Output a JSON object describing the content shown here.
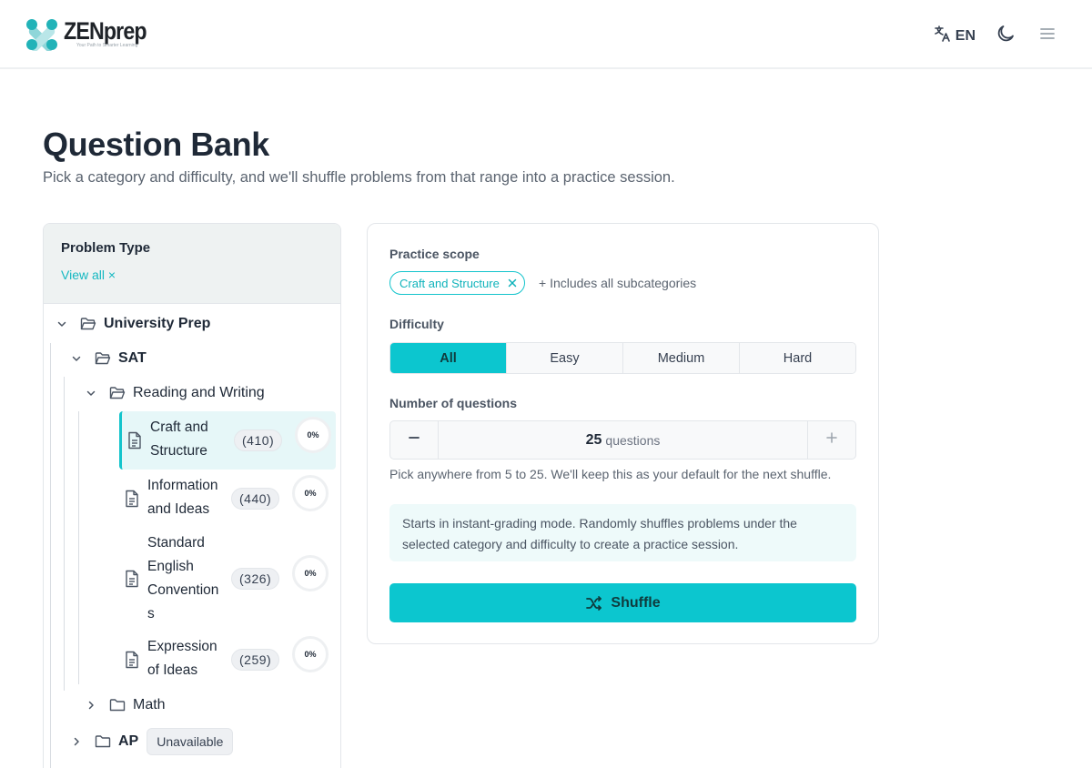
{
  "header": {
    "logo_text": "ZENprep",
    "logo_tagline": "Your Path to Smarter Learning",
    "language": "EN",
    "icons": [
      "translate-icon",
      "moon-icon",
      "hamburger-menu-icon"
    ]
  },
  "page": {
    "title": "Question Bank",
    "subtitle": "Pick a category and difficulty, and we'll shuffle problems from that range into a practice session."
  },
  "sidebar": {
    "title": "Problem Type",
    "view_all": "View all ×",
    "tree": {
      "root": "University Prep",
      "sat": "SAT",
      "reading_writing": "Reading and Writing",
      "leaves": [
        {
          "label": "Craft and Structure",
          "count": "(410)",
          "progress": "0%",
          "active": true
        },
        {
          "label": "Information and Ideas",
          "count": "(440)",
          "progress": "0%",
          "active": false
        },
        {
          "label": "Standard English Convention s",
          "count": "(326)",
          "progress": "0%",
          "active": false
        },
        {
          "label": "Expression of Ideas",
          "count": "(259)",
          "progress": "0%",
          "active": false
        }
      ],
      "math": "Math",
      "ap": "AP",
      "ap_badge": "Unavailable"
    }
  },
  "practice": {
    "scope_label": "Practice scope",
    "scope_chip": "Craft and Structure",
    "scope_note": "+ Includes all subcategories",
    "difficulty_label": "Difficulty",
    "difficulty_options": [
      "All",
      "Easy",
      "Medium",
      "Hard"
    ],
    "difficulty_selected": "All",
    "count_label": "Number of questions",
    "count_value": "25",
    "count_unit": "questions",
    "count_hint": "Pick anywhere from 5 to 25. We'll keep this as your default for the next shuffle.",
    "info_text": "Starts in instant-grading mode. Randomly shuffles problems under the selected category and difficulty to create a practice session.",
    "shuffle_label": "Shuffle"
  },
  "colors": {
    "accent": "#0cc6cf",
    "accent_text": "#14b8c1",
    "active_bg": "#e6f7f8",
    "info_bg": "#eefafa"
  }
}
